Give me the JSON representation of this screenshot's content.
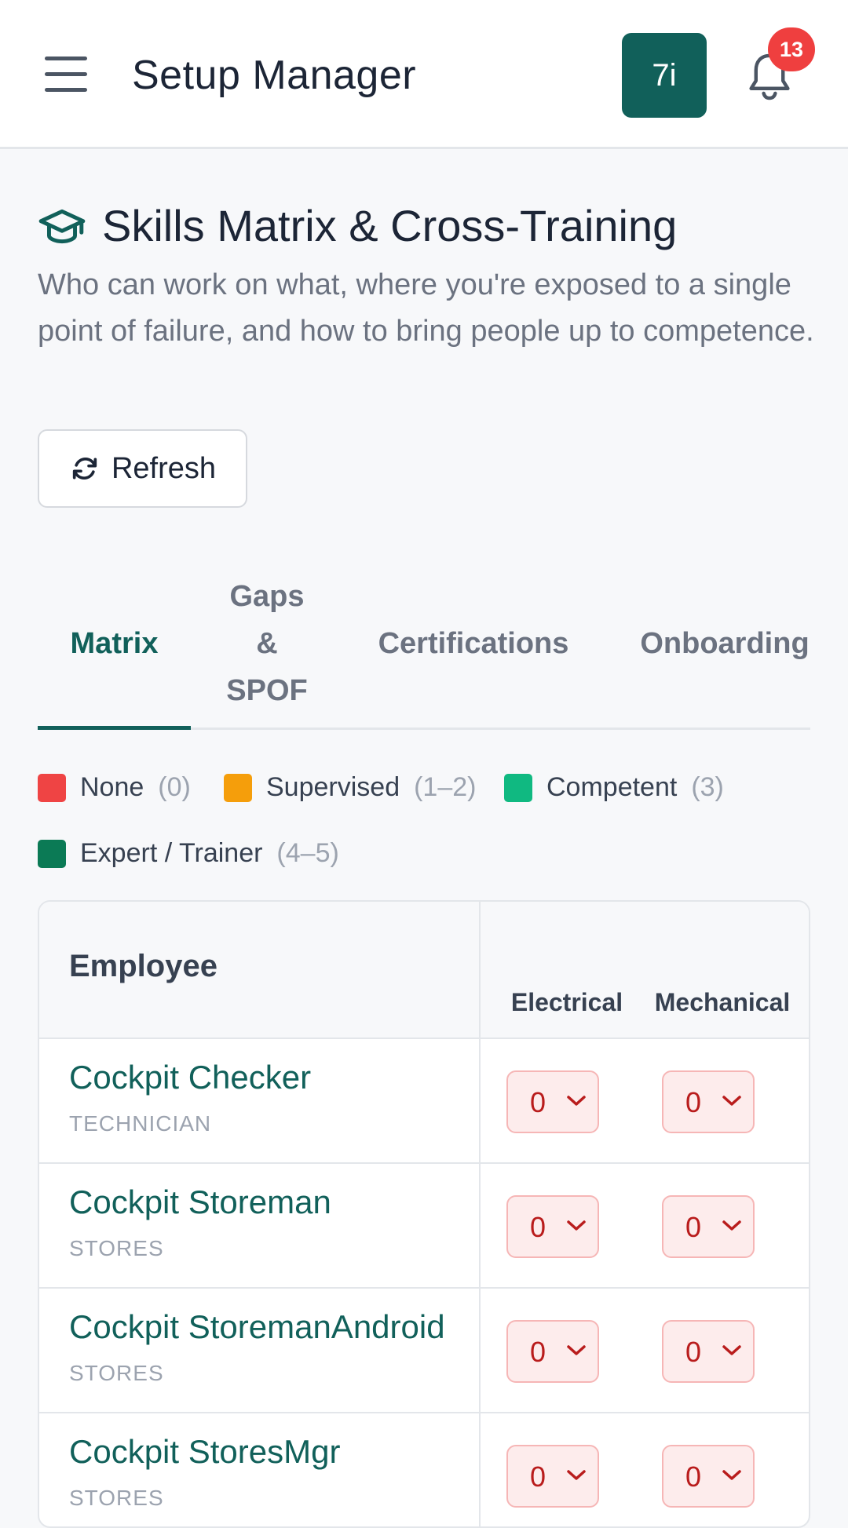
{
  "header": {
    "app_title": "Setup Manager",
    "avatar_text": "7i",
    "notification_count": "13"
  },
  "page": {
    "title": "Skills Matrix & Cross-Training",
    "description": "Who can work on what, where you're exposed to a single point of failure, and how to bring people up to competence.",
    "refresh_label": "Refresh"
  },
  "tabs": [
    {
      "label": "Matrix",
      "active": true
    },
    {
      "label": "Gaps & SPOF",
      "active": false
    },
    {
      "label": "Certifications",
      "active": false
    },
    {
      "label": "Onboarding",
      "active": false
    }
  ],
  "tabs_lines": {
    "gaps": [
      "Gaps",
      "&",
      "SPOF"
    ]
  },
  "legend": [
    {
      "label": "None",
      "range": "(0)",
      "color": "#ef4444"
    },
    {
      "label": "Supervised",
      "range": "(1–2)",
      "color": "#f59e0b"
    },
    {
      "label": "Competent",
      "range": "(3)",
      "color": "#10b981"
    },
    {
      "label": "Expert / Trainer",
      "range": "(4–5)",
      "color": "#0b7a55"
    }
  ],
  "table": {
    "employee_header": "Employee",
    "skills": [
      "Electrical",
      "Mechanical"
    ],
    "rows": [
      {
        "name": "Cockpit Checker",
        "role": "TECHNICIAN",
        "levels": [
          "0",
          "0"
        ]
      },
      {
        "name": "Cockpit Storeman",
        "role": "STORES",
        "levels": [
          "0",
          "0"
        ]
      },
      {
        "name": "Cockpit StoremanAndroid",
        "role": "STORES",
        "levels": [
          "0",
          "0"
        ]
      },
      {
        "name": "Cockpit StoresMgr",
        "role": "STORES",
        "levels": [
          "0",
          "0"
        ]
      }
    ]
  },
  "icons": [
    "menu-icon",
    "bell-icon",
    "graduation-cap-icon",
    "refresh-icon",
    "chevron-down-icon"
  ],
  "colors": {
    "accent": "#11605a",
    "badge": "#ef3f3f"
  }
}
